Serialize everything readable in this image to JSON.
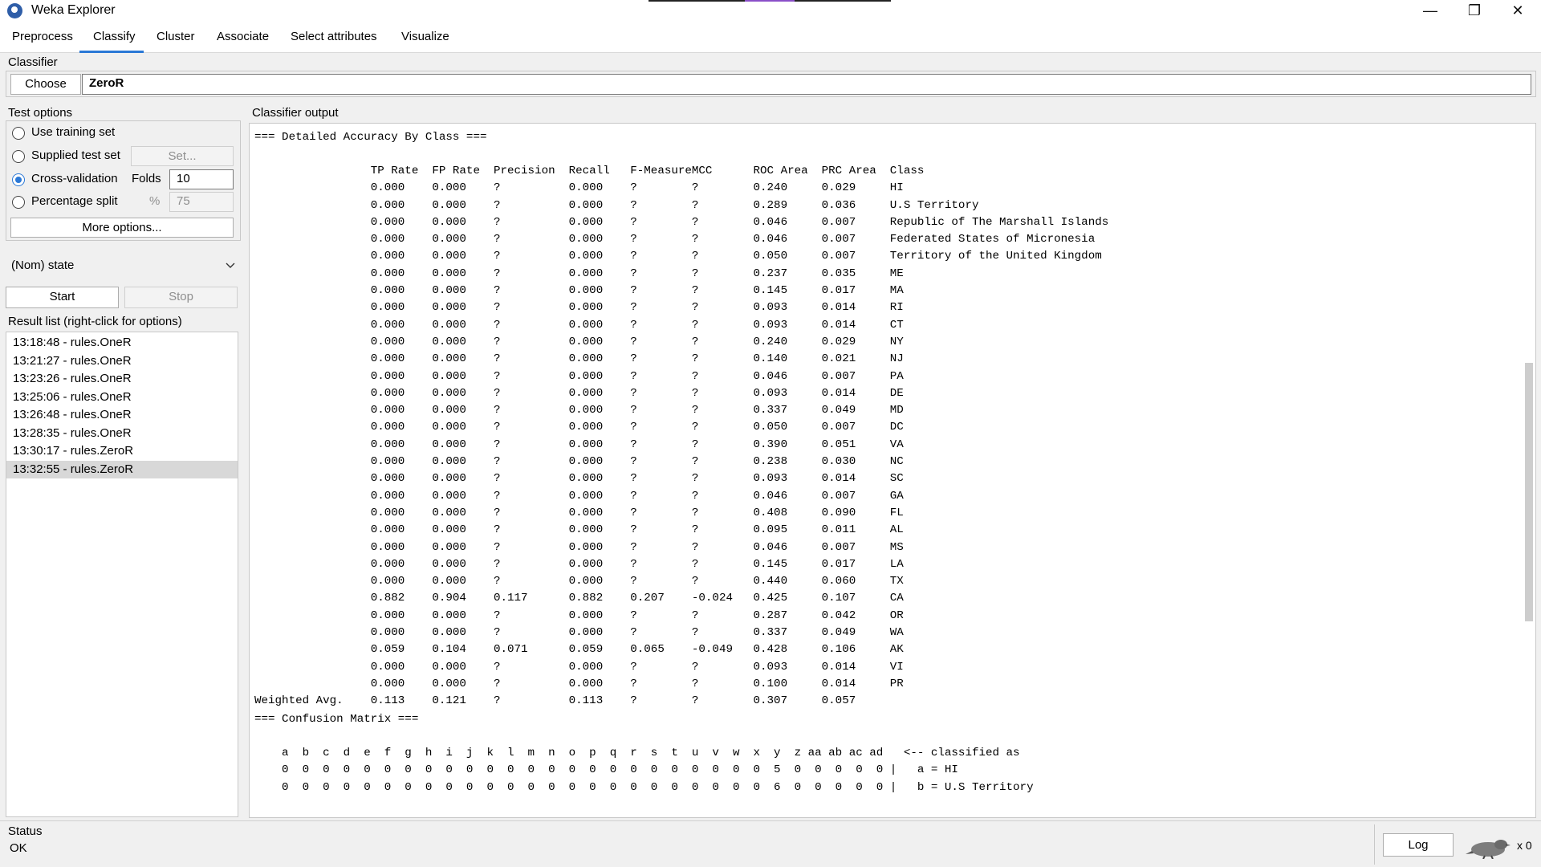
{
  "window": {
    "title": "Weka Explorer",
    "controls": [
      "—",
      "❐",
      "✕"
    ]
  },
  "tabs": [
    "Preprocess",
    "Classify",
    "Cluster",
    "Associate",
    "Select attributes",
    "Visualize"
  ],
  "active_tab": "Classify",
  "classifier": {
    "group_label": "Classifier",
    "choose_label": "Choose",
    "value": "ZeroR"
  },
  "test_options": {
    "group_label": "Test options",
    "use_training": "Use training set",
    "supplied_test": "Supplied test set",
    "set_button": "Set...",
    "cross_validation": "Cross-validation",
    "folds_label": "Folds",
    "folds_value": "10",
    "percentage_split": "Percentage split",
    "percent_symbol": "%",
    "percent_value": "75",
    "more_options": "More options...",
    "selected": "Cross-validation"
  },
  "class_attribute": "(Nom) state",
  "start_label": "Start",
  "stop_label": "Stop",
  "result_list": {
    "label": "Result list (right-click for options)",
    "items": [
      "13:18:48 - rules.OneR",
      "13:21:27 - rules.OneR",
      "13:23:26 - rules.OneR",
      "13:25:06 - rules.OneR",
      "13:26:48 - rules.OneR",
      "13:28:35 - rules.OneR",
      "13:30:17 - rules.ZeroR",
      "13:32:55 - rules.ZeroR"
    ],
    "selected_index": 7
  },
  "output": {
    "label": "Classifier output",
    "accuracy_header": "=== Detailed Accuracy By Class ===",
    "columns": [
      "TP Rate",
      "FP Rate",
      "Precision",
      "Recall",
      "F-Measure",
      "MCC",
      "ROC Area",
      "PRC Area",
      "Class"
    ],
    "rows": [
      [
        "",
        "0.000",
        "0.000",
        "?",
        "0.000",
        "?",
        "?",
        "0.240",
        "0.029",
        "HI"
      ],
      [
        "",
        "0.000",
        "0.000",
        "?",
        "0.000",
        "?",
        "?",
        "0.289",
        "0.036",
        "U.S Territory"
      ],
      [
        "",
        "0.000",
        "0.000",
        "?",
        "0.000",
        "?",
        "?",
        "0.046",
        "0.007",
        "Republic of The Marshall Islands"
      ],
      [
        "",
        "0.000",
        "0.000",
        "?",
        "0.000",
        "?",
        "?",
        "0.046",
        "0.007",
        "Federated States of Micronesia"
      ],
      [
        "",
        "0.000",
        "0.000",
        "?",
        "0.000",
        "?",
        "?",
        "0.050",
        "0.007",
        "Territory of the United Kingdom"
      ],
      [
        "",
        "0.000",
        "0.000",
        "?",
        "0.000",
        "?",
        "?",
        "0.237",
        "0.035",
        "ME"
      ],
      [
        "",
        "0.000",
        "0.000",
        "?",
        "0.000",
        "?",
        "?",
        "0.145",
        "0.017",
        "MA"
      ],
      [
        "",
        "0.000",
        "0.000",
        "?",
        "0.000",
        "?",
        "?",
        "0.093",
        "0.014",
        "RI"
      ],
      [
        "",
        "0.000",
        "0.000",
        "?",
        "0.000",
        "?",
        "?",
        "0.093",
        "0.014",
        "CT"
      ],
      [
        "",
        "0.000",
        "0.000",
        "?",
        "0.000",
        "?",
        "?",
        "0.240",
        "0.029",
        "NY"
      ],
      [
        "",
        "0.000",
        "0.000",
        "?",
        "0.000",
        "?",
        "?",
        "0.140",
        "0.021",
        "NJ"
      ],
      [
        "",
        "0.000",
        "0.000",
        "?",
        "0.000",
        "?",
        "?",
        "0.046",
        "0.007",
        "PA"
      ],
      [
        "",
        "0.000",
        "0.000",
        "?",
        "0.000",
        "?",
        "?",
        "0.093",
        "0.014",
        "DE"
      ],
      [
        "",
        "0.000",
        "0.000",
        "?",
        "0.000",
        "?",
        "?",
        "0.337",
        "0.049",
        "MD"
      ],
      [
        "",
        "0.000",
        "0.000",
        "?",
        "0.000",
        "?",
        "?",
        "0.050",
        "0.007",
        "DC"
      ],
      [
        "",
        "0.000",
        "0.000",
        "?",
        "0.000",
        "?",
        "?",
        "0.390",
        "0.051",
        "VA"
      ],
      [
        "",
        "0.000",
        "0.000",
        "?",
        "0.000",
        "?",
        "?",
        "0.238",
        "0.030",
        "NC"
      ],
      [
        "",
        "0.000",
        "0.000",
        "?",
        "0.000",
        "?",
        "?",
        "0.093",
        "0.014",
        "SC"
      ],
      [
        "",
        "0.000",
        "0.000",
        "?",
        "0.000",
        "?",
        "?",
        "0.046",
        "0.007",
        "GA"
      ],
      [
        "",
        "0.000",
        "0.000",
        "?",
        "0.000",
        "?",
        "?",
        "0.408",
        "0.090",
        "FL"
      ],
      [
        "",
        "0.000",
        "0.000",
        "?",
        "0.000",
        "?",
        "?",
        "0.095",
        "0.011",
        "AL"
      ],
      [
        "",
        "0.000",
        "0.000",
        "?",
        "0.000",
        "?",
        "?",
        "0.046",
        "0.007",
        "MS"
      ],
      [
        "",
        "0.000",
        "0.000",
        "?",
        "0.000",
        "?",
        "?",
        "0.145",
        "0.017",
        "LA"
      ],
      [
        "",
        "0.000",
        "0.000",
        "?",
        "0.000",
        "?",
        "?",
        "0.440",
        "0.060",
        "TX"
      ],
      [
        "",
        "0.882",
        "0.904",
        "0.117",
        "0.882",
        "0.207",
        "-0.024",
        "0.425",
        "0.107",
        "CA"
      ],
      [
        "",
        "0.000",
        "0.000",
        "?",
        "0.000",
        "?",
        "?",
        "0.287",
        "0.042",
        "OR"
      ],
      [
        "",
        "0.000",
        "0.000",
        "?",
        "0.000",
        "?",
        "?",
        "0.337",
        "0.049",
        "WA"
      ],
      [
        "",
        "0.059",
        "0.104",
        "0.071",
        "0.059",
        "0.065",
        "-0.049",
        "0.428",
        "0.106",
        "AK"
      ],
      [
        "",
        "0.000",
        "0.000",
        "?",
        "0.000",
        "?",
        "?",
        "0.093",
        "0.014",
        "VI"
      ],
      [
        "",
        "0.000",
        "0.000",
        "?",
        "0.000",
        "?",
        "?",
        "0.100",
        "0.014",
        "PR"
      ],
      [
        "Weighted Avg.",
        "0.113",
        "0.121",
        "?",
        "0.113",
        "?",
        "?",
        "0.307",
        "0.057",
        ""
      ]
    ],
    "confusion_header": "=== Confusion Matrix ===",
    "confusion_columns": [
      "a",
      "b",
      "c",
      "d",
      "e",
      "f",
      "g",
      "h",
      "i",
      "j",
      "k",
      "l",
      "m",
      "n",
      "o",
      "p",
      "q",
      "r",
      "s",
      "t",
      "u",
      "v",
      "w",
      "x",
      "y",
      "z",
      "aa",
      "ab",
      "ac",
      "ad"
    ],
    "confusion_suffix": "<-- classified as",
    "confusion_rows": [
      {
        "values": [
          0,
          0,
          0,
          0,
          0,
          0,
          0,
          0,
          0,
          0,
          0,
          0,
          0,
          0,
          0,
          0,
          0,
          0,
          0,
          0,
          0,
          0,
          0,
          0,
          5,
          0,
          0,
          0,
          0,
          0
        ],
        "label": "a = HI"
      },
      {
        "values": [
          0,
          0,
          0,
          0,
          0,
          0,
          0,
          0,
          0,
          0,
          0,
          0,
          0,
          0,
          0,
          0,
          0,
          0,
          0,
          0,
          0,
          0,
          0,
          0,
          6,
          0,
          0,
          0,
          0,
          0
        ],
        "label": "b = U.S Territory"
      }
    ]
  },
  "status": {
    "label": "Status",
    "text": "OK",
    "log_button": "Log",
    "count": "x 0"
  }
}
